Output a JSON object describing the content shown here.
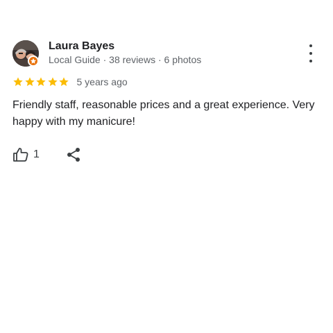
{
  "author": {
    "name": "Laura Bayes",
    "meta": "Local Guide · 38 reviews · 6 photos",
    "avatar_icon": "profile-photo",
    "badge_icon": "local-guide-star-icon",
    "badge_color": "#e8710a"
  },
  "rating": {
    "stars": 5,
    "max_stars": 5,
    "star_color": "#fbbc04",
    "date": "5 years ago"
  },
  "review": {
    "text": "Friendly staff, reasonable prices and a great experience. Very happy with my manicure!"
  },
  "actions": {
    "like_icon": "thumbs-up-icon",
    "like_count": "1",
    "share_icon": "share-icon",
    "more_icon": "more-vertical-icon"
  }
}
